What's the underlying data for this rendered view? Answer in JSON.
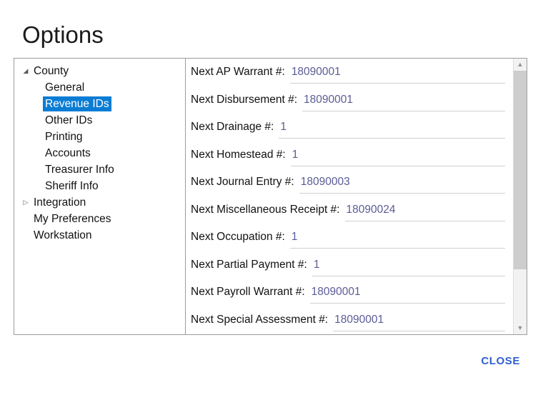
{
  "dialog": {
    "title": "Options",
    "close_label": "CLOSE",
    "accent_color": "#2f5fd0",
    "selection_color": "#0a7cd4",
    "value_color": "#5b5b96"
  },
  "tree": {
    "nodes": [
      {
        "label": "County",
        "level": 0,
        "expander": "expanded",
        "selected": false
      },
      {
        "label": "General",
        "level": 1,
        "expander": "none",
        "selected": false
      },
      {
        "label": "Revenue IDs",
        "level": 1,
        "expander": "none",
        "selected": true
      },
      {
        "label": "Other IDs",
        "level": 1,
        "expander": "none",
        "selected": false
      },
      {
        "label": "Printing",
        "level": 1,
        "expander": "none",
        "selected": false
      },
      {
        "label": "Accounts",
        "level": 1,
        "expander": "none",
        "selected": false
      },
      {
        "label": "Treasurer Info",
        "level": 1,
        "expander": "none",
        "selected": false
      },
      {
        "label": "Sheriff Info",
        "level": 1,
        "expander": "none",
        "selected": false
      },
      {
        "label": "Integration",
        "level": 0,
        "expander": "collapsed",
        "selected": false
      },
      {
        "label": "My Preferences",
        "level": 0,
        "expander": "none",
        "selected": false
      },
      {
        "label": "Workstation",
        "level": 0,
        "expander": "none",
        "selected": false
      }
    ]
  },
  "form": {
    "fields": [
      {
        "label": "Next AP Warrant #:",
        "value": "18090001"
      },
      {
        "label": "Next Disbursement #:",
        "value": "18090001"
      },
      {
        "label": "Next Drainage #:",
        "value": "1"
      },
      {
        "label": "Next Homestead #:",
        "value": "1"
      },
      {
        "label": "Next Journal Entry #:",
        "value": "18090003"
      },
      {
        "label": "Next Miscellaneous Receipt #:",
        "value": "18090024"
      },
      {
        "label": "Next Occupation #:",
        "value": "1"
      },
      {
        "label": "Next Partial Payment #:",
        "value": "1"
      },
      {
        "label": "Next Payroll Warrant #:",
        "value": "18090001"
      },
      {
        "label": "Next Special Assessment #:",
        "value": "18090001"
      }
    ]
  },
  "scrollbar": {
    "up_arrow_icon": "chevron-up-icon",
    "down_arrow_icon": "chevron-down-icon"
  },
  "icons": {
    "expanded": "triangle-down-filled-icon",
    "collapsed": "triangle-right-outline-icon"
  }
}
